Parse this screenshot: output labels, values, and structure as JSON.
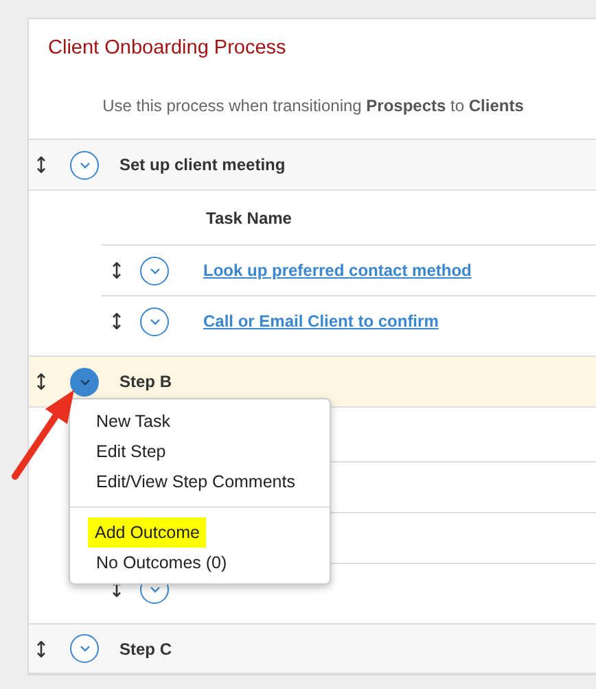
{
  "title": "Client Onboarding Process",
  "description": "Use this process when transitioning **Prospects** to **Clients**",
  "steps": [
    {
      "name": "Set up client meeting",
      "selected": false,
      "task_header": "Task Name",
      "tasks": [
        {
          "kind": "task",
          "name": "Look up preferred contact method"
        },
        {
          "kind": "task",
          "name": "Call or Email Client to confirm"
        }
      ]
    },
    {
      "name": "Step B",
      "selected": true,
      "tasks": [
        {
          "kind": "hidden"
        },
        {
          "kind": "hidden"
        },
        {
          "kind": "icons"
        }
      ]
    },
    {
      "name": "Step C",
      "selected": false
    }
  ],
  "menu": {
    "items": [
      {
        "kind": "item",
        "label": "New Task",
        "highlighted": false
      },
      {
        "kind": "item",
        "label": "Edit Step",
        "highlighted": false
      },
      {
        "kind": "item",
        "label": "Edit/View Step Comments",
        "highlighted": false
      },
      {
        "kind": "divider"
      },
      {
        "kind": "item",
        "label": "Add Outcome",
        "highlighted": true
      },
      {
        "kind": "item",
        "label": "No Outcomes (0)",
        "highlighted": false
      }
    ]
  }
}
